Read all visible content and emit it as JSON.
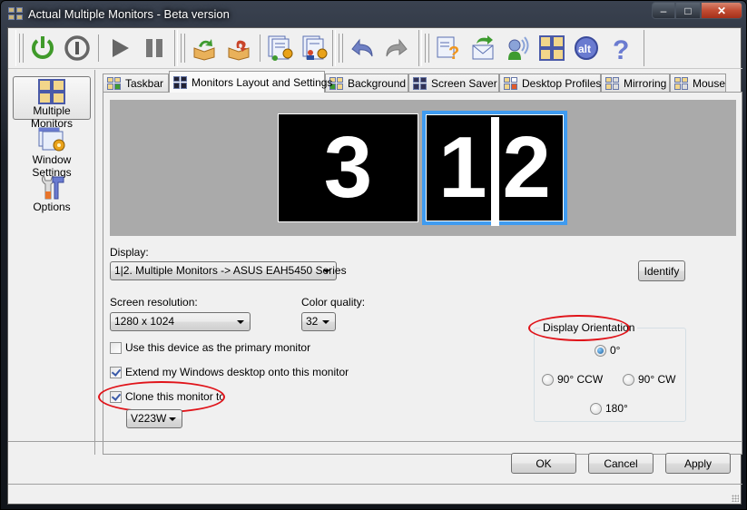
{
  "window": {
    "title": "Actual Multiple Monitors - Beta version",
    "controls": {
      "minimize": "–",
      "maximize": "□",
      "close": "✕"
    }
  },
  "toolbar": {
    "groups": [
      [
        "power-on-icon",
        "power-off-icon",
        "|",
        "play-icon",
        "pause-icon"
      ],
      [
        "box-import-icon",
        "box-export-icon",
        "|",
        "profile-settings-icon",
        "user-settings-icon"
      ],
      [
        "undo-icon",
        "redo-icon"
      ],
      [
        "help-document-icon",
        "email-icon",
        "contact-support-icon",
        "monitors-icon",
        "actual-tools-icon",
        "help-icon"
      ]
    ]
  },
  "sidebar": {
    "items": [
      {
        "label": "Multiple Monitors",
        "icon": "multiple-monitors-icon",
        "active": true
      },
      {
        "label": "Window Settings",
        "icon": "window-settings-icon",
        "active": false
      },
      {
        "label": "Options",
        "icon": "options-icon",
        "active": false
      }
    ]
  },
  "tabs": [
    {
      "label": "Taskbar",
      "active": false
    },
    {
      "label": "Monitors Layout and Settings",
      "active": true
    },
    {
      "label": "Background",
      "active": false
    },
    {
      "label": "Screen Saver",
      "active": false
    },
    {
      "label": "Desktop Profiles",
      "active": false
    },
    {
      "label": "Mirroring",
      "active": false
    },
    {
      "label": "Mouse",
      "active": false
    }
  ],
  "layout": {
    "monitors": [
      {
        "label": "3",
        "selected": false
      },
      {
        "label_left": "1",
        "label_right": "2",
        "selected": true
      }
    ],
    "colors": {
      "background": "#aaaaaa",
      "selected_border": "#3f9bf0"
    }
  },
  "settings": {
    "display_label": "Display:",
    "display_value": "1|2. Multiple Monitors -> ASUS EAH5450 Series",
    "identify_button": "Identify",
    "resolution_label": "Screen resolution:",
    "resolution_value": "1280 x 1024",
    "color_label": "Color quality:",
    "color_value": "32",
    "primary_checkbox": {
      "label": "Use this device as the primary monitor",
      "checked": false
    },
    "extend_checkbox": {
      "label": "Extend my Windows desktop onto this monitor",
      "checked": true
    },
    "clone_checkbox": {
      "label": "Clone this monitor to",
      "checked": true
    },
    "clone_target": "V223W",
    "orientation": {
      "title": "Display Orientation",
      "options": [
        {
          "label": "0°",
          "selected": true
        },
        {
          "label": "90° CCW",
          "selected": false
        },
        {
          "label": "90° CW",
          "selected": false
        },
        {
          "label": "180°",
          "selected": false
        }
      ]
    }
  },
  "footer": {
    "ok": "OK",
    "cancel": "Cancel",
    "apply": "Apply"
  },
  "annotation_color": "#e0141a"
}
